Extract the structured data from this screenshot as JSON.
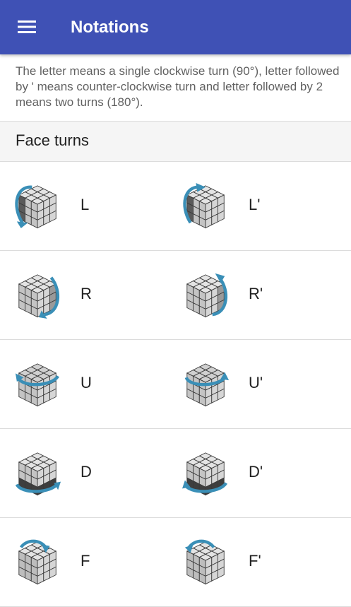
{
  "appbar": {
    "title": "Notations",
    "menu_icon": "hamburger-menu-icon"
  },
  "intro": "The letter means a single clockwise turn (90°), letter followed by ' means counter-clockwise turn and letter followed by 2 means two turns (180°).",
  "section": {
    "title": "Face turns"
  },
  "colors": {
    "primary": "#3f51b5",
    "arrow": "#3a8fb7",
    "cube": "#c8c8c8"
  },
  "rows": [
    {
      "left": {
        "label": "L",
        "icon": "cube-L-turn-icon"
      },
      "right": {
        "label": "L'",
        "icon": "cube-L-prime-turn-icon"
      }
    },
    {
      "left": {
        "label": "R",
        "icon": "cube-R-turn-icon"
      },
      "right": {
        "label": "R'",
        "icon": "cube-R-prime-turn-icon"
      }
    },
    {
      "left": {
        "label": "U",
        "icon": "cube-U-turn-icon"
      },
      "right": {
        "label": "U'",
        "icon": "cube-U-prime-turn-icon"
      }
    },
    {
      "left": {
        "label": "D",
        "icon": "cube-D-turn-icon"
      },
      "right": {
        "label": "D'",
        "icon": "cube-D-prime-turn-icon"
      }
    },
    {
      "left": {
        "label": "F",
        "icon": "cube-F-turn-icon"
      },
      "right": {
        "label": "F'",
        "icon": "cube-F-prime-turn-icon"
      }
    }
  ]
}
